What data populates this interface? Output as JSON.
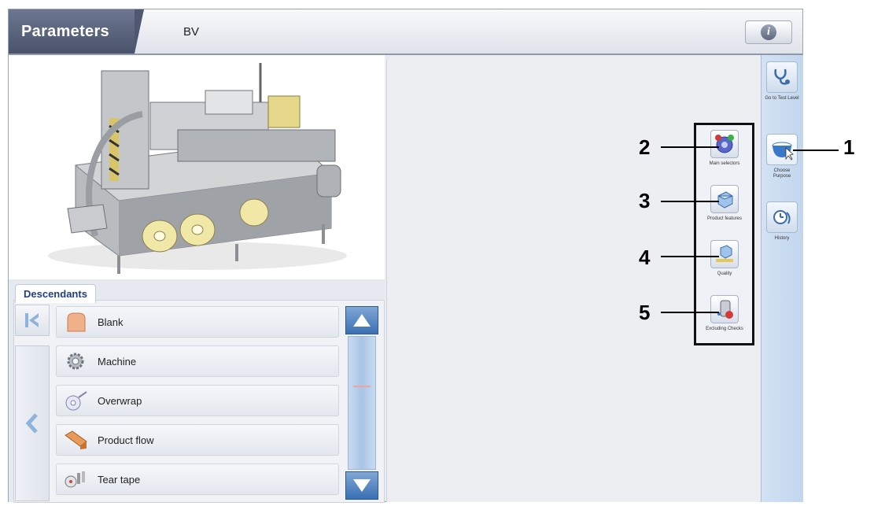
{
  "header": {
    "title": "Parameters",
    "subtitle": "BV",
    "info_label": "i"
  },
  "descendants": {
    "tab_label": "Descendants",
    "items": [
      {
        "label": "Blank",
        "icon": "blank-icon"
      },
      {
        "label": "Machine",
        "icon": "gear-icon"
      },
      {
        "label": "Overwrap",
        "icon": "overwrap-roll-icon"
      },
      {
        "label": "Product flow",
        "icon": "product-flow-icon"
      },
      {
        "label": "Tear tape",
        "icon": "tear-tape-icon"
      }
    ]
  },
  "sidebar": {
    "items": [
      {
        "label": "Go to Test Level",
        "icon": "stethoscope-icon"
      },
      {
        "label": "Choose Purpose",
        "icon": "bowl-icon"
      },
      {
        "label": "History",
        "icon": "history-stethoscope-icon"
      }
    ]
  },
  "submenu": {
    "items": [
      {
        "label": "Main selectors",
        "icon": "main-selectors-icon"
      },
      {
        "label": "Product features",
        "icon": "product-features-icon"
      },
      {
        "label": "Quality",
        "icon": "quality-icon"
      },
      {
        "label": "Excluding Checks",
        "icon": "excluding-checks-icon"
      }
    ]
  },
  "callouts": [
    "1",
    "2",
    "3",
    "4",
    "5"
  ],
  "colors": {
    "header_dark": "#4a536b",
    "accent_blue": "#3a6fb2",
    "callout_border": "#111111"
  }
}
